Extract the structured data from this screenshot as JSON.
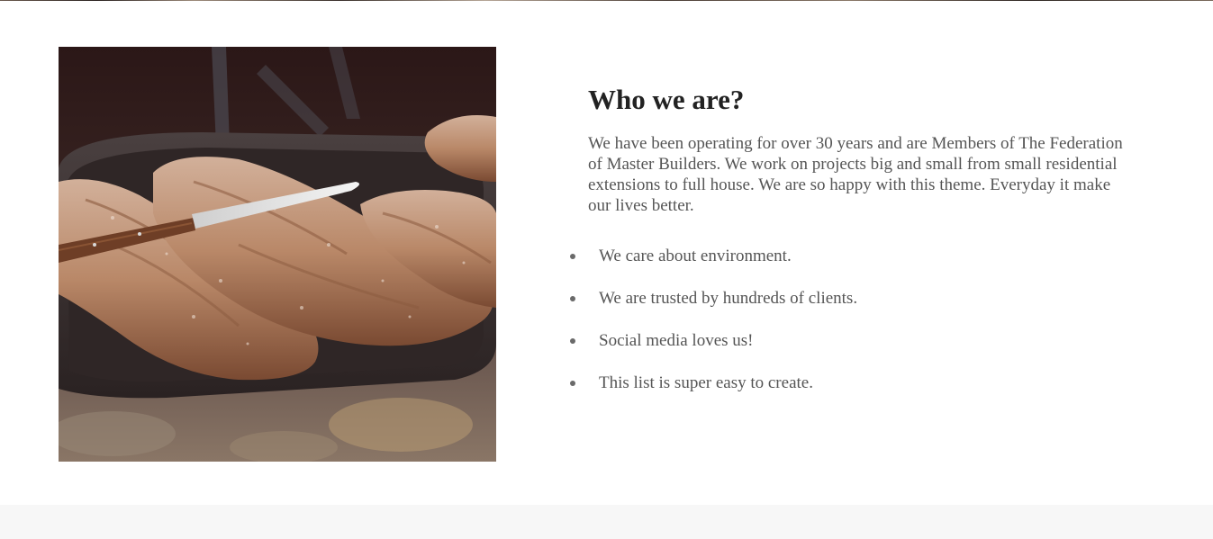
{
  "about": {
    "image_alt": "Baked bread loaves on a tray with a knife",
    "heading": "Who we are?",
    "intro": "We have been operating for over 30 years and are Members of The Federation of Master Builders. We work on projects big and small from small residential extensions to full house. We are so happy with this theme. Everyday it make our lives better.",
    "features": [
      "We care about environment.",
      "We are trusted by hundreds of clients.",
      "Social media loves us!",
      "This list is super easy to create."
    ]
  },
  "colors": {
    "heading": "#222222",
    "body_text": "#555555",
    "bullet": "#6a6a6a",
    "footer_band": "#f7f7f7"
  }
}
